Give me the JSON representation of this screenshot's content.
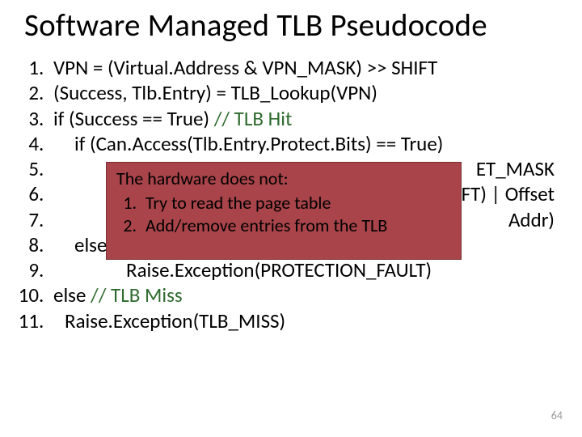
{
  "title": "Software Managed TLB Pseudocode",
  "code": {
    "l1": "VPN = (Virtual.Address & VPN_MASK) >> SHIFT",
    "l2": "(Success, Tlb.Entry) = TLB_Lookup(VPN)",
    "l3_a": "if (Success == True) ",
    "l3_b": "// TLB Hit",
    "l4": "if (Can.Access(Tlb.Entry.Protect.Bits) == True)",
    "l5_a": "",
    "l5_b": "ET_MASK",
    "l6_a": "",
    "l6_b": "HIFT) | Offset",
    "l7_a": "",
    "l7_b": "Addr)",
    "l8": "else",
    "l9": "Raise.Exception(PROTECTION_FAULT)",
    "l10_a": "else ",
    "l10_b": "// TLB Miss",
    "l11": "Raise.Exception(TLB_MISS)"
  },
  "overlay": {
    "header": "The hardware does not:",
    "items": [
      "Try to read the page table",
      "Add/remove entries from the TLB"
    ]
  },
  "page_number": "64"
}
